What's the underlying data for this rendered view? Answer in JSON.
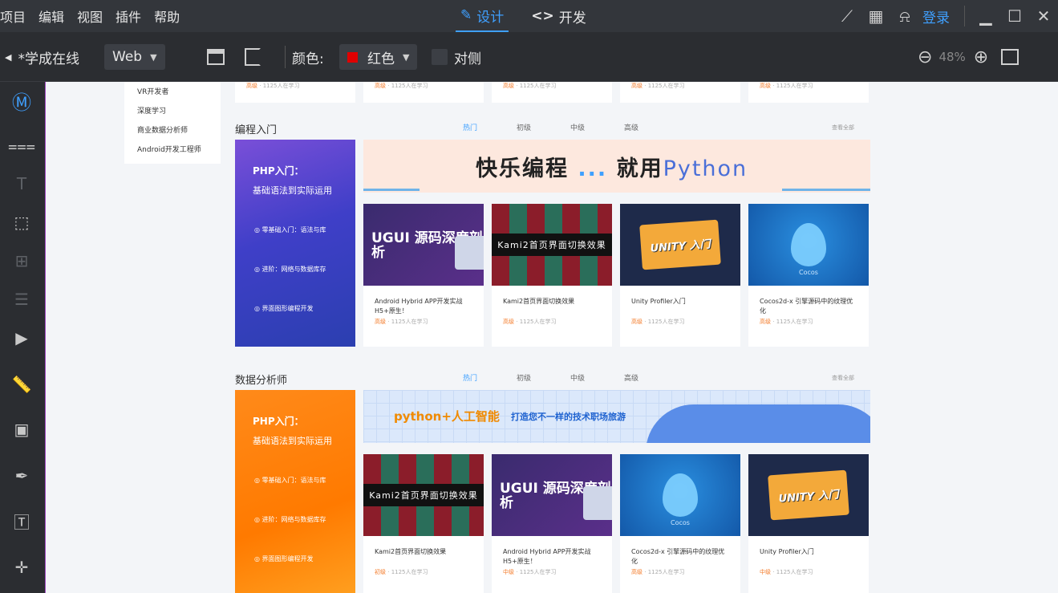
{
  "menubar": {
    "items": [
      "项目",
      "编辑",
      "视图",
      "插件",
      "帮助"
    ],
    "modes": [
      {
        "label": "设计",
        "icon": "pencil-icon",
        "active": true
      },
      {
        "label": "开发",
        "icon": "code-icon",
        "active": false
      }
    ],
    "login": "登录"
  },
  "toolbar": {
    "project": "*学成在线",
    "platform": "Web",
    "color_label": "颜色:",
    "color_value": "红色",
    "color_hex": "#e00000",
    "opposite": "对侧",
    "zoom": "48%"
  },
  "canvas": {
    "side_menu": [
      "VR开发者",
      "深度学习",
      "商业数据分析师",
      "Android开发工程师"
    ],
    "top_cards_meta": {
      "level": "高级",
      "count": "1125人在学习"
    },
    "sections": [
      {
        "title": "编程入门",
        "tabs": [
          "热门",
          "初级",
          "中级",
          "高级"
        ],
        "more": "查看全部",
        "promo": {
          "title": "PHP入门：",
          "subtitle": "基础语法到实际运用",
          "steps": [
            "零基础入门：语法与库",
            "进阶：网络与数据库存",
            "界面图形编程开发"
          ]
        },
        "banner": {
          "left": "快乐编程",
          "mid": "就用",
          "right": "Python"
        },
        "cards": [
          {
            "thumb": "UGUI 源码深度剖析",
            "title": "Android Hybrid APP开发实战 H5+原生！",
            "level": "高级",
            "count": "1125人在学习",
            "kind": "ugui"
          },
          {
            "thumb": "Kami2首页界面切换效果",
            "title": "Kami2首页界面切换效果",
            "level": "高级",
            "count": "1125人在学习",
            "kind": "kami"
          },
          {
            "thumb": "UNITY 入门",
            "title": "Unity Profiler入门",
            "level": "高级",
            "count": "1125人在学习",
            "kind": "unity"
          },
          {
            "thumb": "Cocos",
            "title": "Cocos2d-x 引擎源码中的纹理优化",
            "level": "高级",
            "count": "1125人在学习",
            "kind": "cocos"
          }
        ]
      },
      {
        "title": "数据分析师",
        "tabs": [
          "热门",
          "初级",
          "中级",
          "高级"
        ],
        "more": "查看全部",
        "promo": {
          "title": "PHP入门：",
          "subtitle": "基础语法到实际运用",
          "steps": [
            "零基础入门：语法与库",
            "进阶：网络与数据库存",
            "界面图形编程开发"
          ]
        },
        "banner": {
          "left": "python+人工智能",
          "mid": "打造您不一样的技术职场旅游",
          "right": ""
        },
        "cards": [
          {
            "thumb": "Kami2首页界面切换效果",
            "title": "Kami2首页界面切换效果",
            "level": "初级",
            "count": "1125人在学习",
            "kind": "kami"
          },
          {
            "thumb": "UGUI 源码深度剖析",
            "title": "Android Hybrid APP开发实战 H5+原生！",
            "level": "中级",
            "count": "1125人在学习",
            "kind": "ugui"
          },
          {
            "thumb": "Cocos",
            "title": "Cocos2d-x 引擎源码中的纹理优化",
            "level": "高级",
            "count": "1125人在学习",
            "kind": "cocos"
          },
          {
            "thumb": "UNITY 入门",
            "title": "Unity Profiler入门",
            "level": "中级",
            "count": "1125人在学习",
            "kind": "unity"
          }
        ]
      }
    ]
  }
}
